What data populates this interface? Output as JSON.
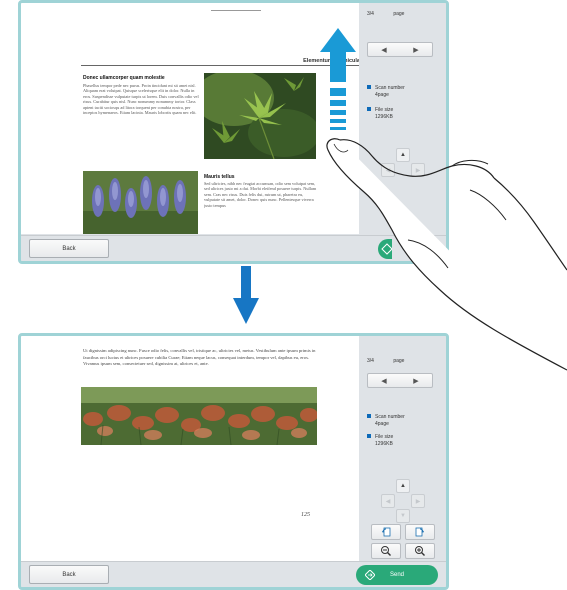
{
  "top_screen": {
    "section_title": "Elementum ut ehicula",
    "article1": {
      "heading": "Donec ullamcorper quam molestie",
      "body": "Phasellus tempor pede nec purus. Proin tincidunt mi sit amet nisl. Aliquam erat volutpat. Quisque scelerisque elit in dolor. Nulla in eros. Suspendisse vulputate turpis ut lorem. Duis convallis odio vel risus. Curabitur quis nisl. Nunc nonummy nonummy tortor. Class aptent taciti sociosqu ad litora torquent per conubia nostra, per inceptos hymenaeos. Etiam lacinia. Mauris lobortis quam nec elit."
    },
    "article2": {
      "heading": "Mauris tellus",
      "body": "Sed ultricies, nibh nec feugiat accumsan, odio sem volutpat sem, sed ultrices justo mi a dui. Morbi eleifend posuere turpis. Nullam sem. Cras nec risus. Duis felis dui, rutrum ut, pharetra eu, vulputate sit amet, dolor. Donec quis nunc. Pellentesque viverra justo tempus"
    },
    "sidebar": {
      "page_index": "3/4",
      "page_label": "page",
      "scan_number_label": "Scan number",
      "scan_number_value": "4page",
      "file_size_label": "File size",
      "file_size_value": "1296KB"
    },
    "back_label": "Back"
  },
  "bottom_screen": {
    "body": "Ut dignissim adipiscing nunc. Fusce odio felis, convallis vel, tristique ac, ultricies vel, metus. Vestibulum ante ipsum primis in faucibus orci luctus et ultrices posuere cubilia Curae; Etiam neque lacus, consequat interdum, tempor vel, dapibus eu, eros. Vivamus ipsum sem, consectetuer sed, dignissim at, ultrices et, ante.",
    "page_number": "125",
    "sidebar": {
      "page_index": "3/4",
      "page_label": "page",
      "scan_number_label": "Scan number",
      "scan_number_value": "4page",
      "file_size_label": "File size",
      "file_size_value": "1296KB"
    },
    "back_label": "Back",
    "send_label": "Send"
  },
  "icons": {
    "prev": "◀",
    "next": "▶",
    "up": "▲",
    "down": "▼",
    "left": "◀",
    "right": "▶"
  },
  "colors": {
    "frame": "#9fd3d6",
    "panel": "#dfe3e7",
    "accent_blue": "#0d6ab8",
    "swipe_arrow": "#1a9ad6",
    "transition_arrow": "#1776c4",
    "send_green": "#2aa979"
  }
}
